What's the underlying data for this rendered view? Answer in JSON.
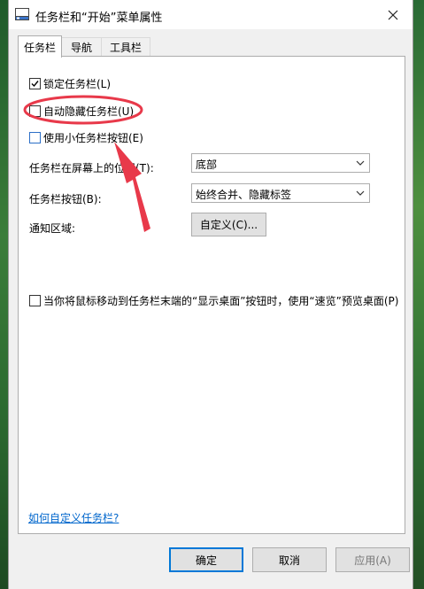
{
  "window": {
    "title": "任务栏和“开始”菜单属性",
    "icons": {
      "app": "taskbar-app-icon",
      "close": "close-icon"
    }
  },
  "tabs": [
    {
      "label": "任务栏",
      "active": true
    },
    {
      "label": "导航",
      "active": false
    },
    {
      "label": "工具栏",
      "active": false
    }
  ],
  "options": {
    "lock_taskbar": {
      "label": "锁定任务栏(L)",
      "checked": true
    },
    "auto_hide": {
      "label": "自动隐藏任务栏(U)",
      "checked": false
    },
    "small_buttons": {
      "label": "使用小任务栏按钮(E)",
      "checked": false
    },
    "peek": {
      "label": "当你将鼠标移动到任务栏末端的“显示桌面”按钮时，使用“速览”预览桌面(P)",
      "checked": false
    }
  },
  "settings": {
    "location": {
      "label": "任务栏在屏幕上的位置(T):",
      "value": "底部"
    },
    "buttons": {
      "label": "任务栏按钮(B):",
      "value": "始终合并、隐藏标签"
    },
    "notification": {
      "label": "通知区域:",
      "button": "自定义(C)..."
    }
  },
  "help_link": "如何自定义任务栏?",
  "footer": {
    "ok": "确定",
    "cancel": "取消",
    "apply": "应用(A)"
  },
  "annotation": {
    "color": "#e8394a"
  }
}
